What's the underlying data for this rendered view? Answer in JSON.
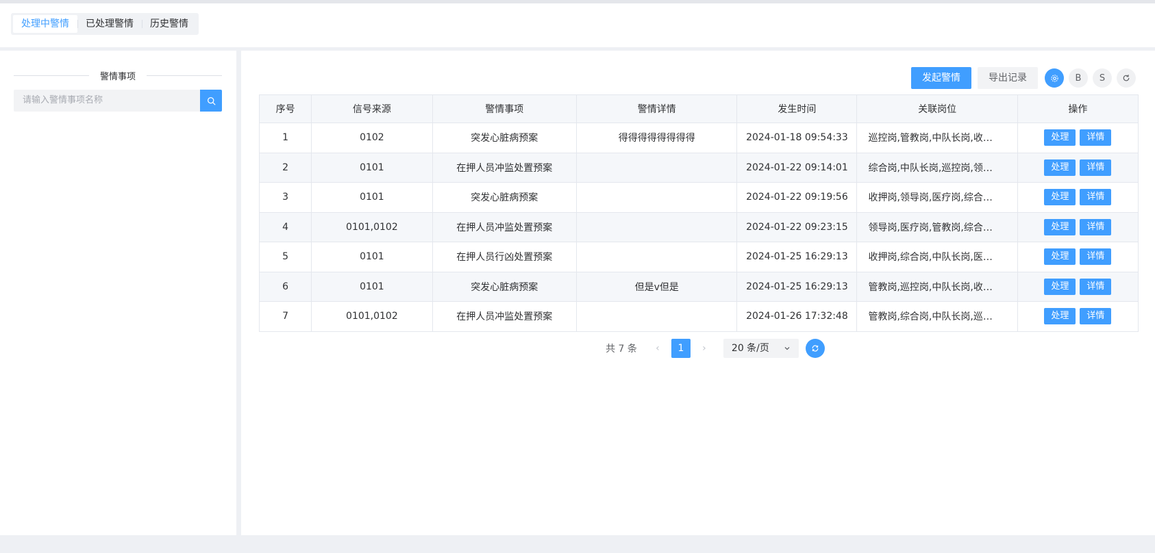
{
  "tabs": [
    {
      "label": "处理中警情",
      "active": true
    },
    {
      "label": "已处理警情",
      "active": false
    },
    {
      "label": "历史警情",
      "active": false
    }
  ],
  "left": {
    "section_title": "警情事项",
    "search_placeholder": "请输入警情事项名称"
  },
  "toolbar": {
    "start_label": "发起警情",
    "export_label": "导出记录",
    "circle_b": "B",
    "circle_s": "S"
  },
  "table": {
    "headers": [
      "序号",
      "信号来源",
      "警情事项",
      "警情详情",
      "发生时间",
      "关联岗位",
      "操作"
    ],
    "rows": [
      {
        "no": "1",
        "source": "0102",
        "item": "突发心脏病预案",
        "detail": "得得得得得得得得",
        "time": "2024-01-18 09:54:33",
        "posts": "巡控岗,管教岗,中队长岗,收押..."
      },
      {
        "no": "2",
        "source": "0101",
        "item": "在押人员冲监处置预案",
        "detail": "",
        "time": "2024-01-22 09:14:01",
        "posts": "综合岗,中队长岗,巡控岗,领导..."
      },
      {
        "no": "3",
        "source": "0101",
        "item": "突发心脏病预案",
        "detail": "",
        "time": "2024-01-22 09:19:56",
        "posts": "收押岗,领导岗,医疗岗,综合岗,..."
      },
      {
        "no": "4",
        "source": "0101,0102",
        "item": "在押人员冲监处置预案",
        "detail": "",
        "time": "2024-01-22 09:23:15",
        "posts": "领导岗,医疗岗,管教岗,综合岗,..."
      },
      {
        "no": "5",
        "source": "0101",
        "item": "在押人员行凶处置预案",
        "detail": "",
        "time": "2024-01-25 16:29:13",
        "posts": "收押岗,综合岗,中队长岗,医疗..."
      },
      {
        "no": "6",
        "source": "0101",
        "item": "突发心脏病预案",
        "detail": "但是v但是",
        "time": "2024-01-25 16:29:13",
        "posts": "管教岗,巡控岗,中队长岗,收押..."
      },
      {
        "no": "7",
        "source": "0101,0102",
        "item": "在押人员冲监处置预案",
        "detail": "",
        "time": "2024-01-26 17:32:48",
        "posts": "管教岗,综合岗,中队长岗,巡控..."
      }
    ],
    "process_label": "处理",
    "detail_label": "详情"
  },
  "pager": {
    "total": "共 7 条",
    "current_page": "1",
    "page_size": "20 条/页"
  },
  "colors": {
    "primary": "#409eff",
    "stripe": "#f5f7fa",
    "border": "#e4e7ed"
  }
}
